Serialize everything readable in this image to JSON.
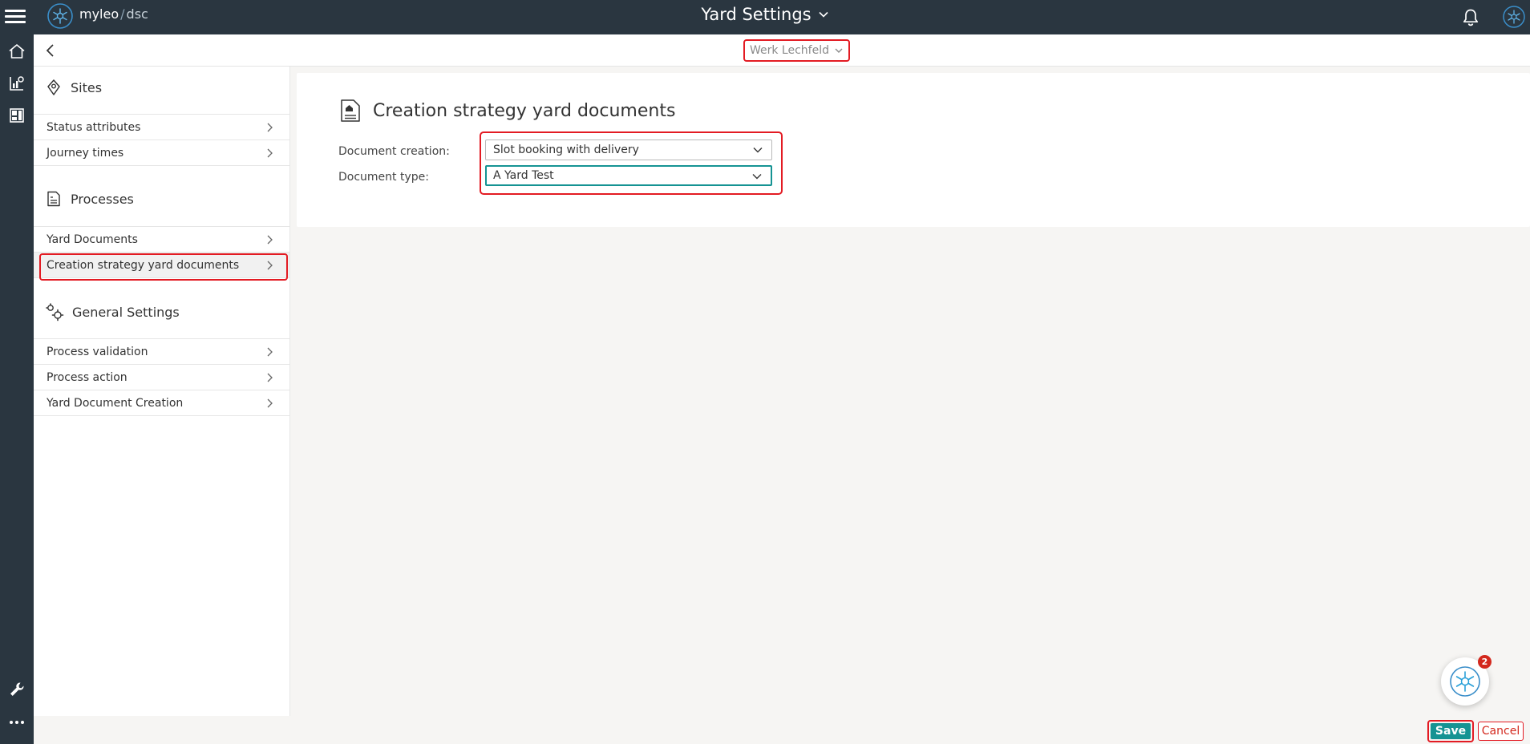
{
  "header": {
    "brand_name": "myleo",
    "brand_separator": "/",
    "brand_suffix": "dsc",
    "page_title": "Yard Settings",
    "icons": [
      "hamburger-menu-icon",
      "logo-icon",
      "chevron-down-icon",
      "bell-icon",
      "user-avatar-icon"
    ]
  },
  "rail": {
    "icons": [
      "home-icon",
      "analytics-icon",
      "dashboard-icon",
      "wrench-icon",
      "more-icon"
    ]
  },
  "subheader": {
    "site_select_value": "Werk Lechfeld"
  },
  "sidebar": {
    "sections": [
      {
        "title": "Sites",
        "icon": "map-pin-icon",
        "items": [
          "Status attributes",
          "Journey times"
        ]
      },
      {
        "title": "Processes",
        "icon": "document-list-icon",
        "items": [
          "Yard Documents",
          "Creation strategy yard documents"
        ]
      },
      {
        "title": "General Settings",
        "icon": "gears-icon",
        "items": [
          "Process validation",
          "Process action",
          "Yard Document Creation"
        ]
      }
    ],
    "active_item": "Creation strategy yard documents"
  },
  "main": {
    "title": "Creation strategy yard documents",
    "title_icon": "yard-document-icon",
    "fields": [
      {
        "label": "Document creation:",
        "value": "Slot booking with delivery"
      },
      {
        "label": "Document type:",
        "value": "A Yard Test"
      }
    ]
  },
  "chat": {
    "badge_count": "2"
  },
  "footer": {
    "save_label": "Save",
    "cancel_label": "Cancel"
  },
  "colors": {
    "header_bg": "#2a3640",
    "accent_teal": "#159393",
    "highlight_red": "#e31b23",
    "badge_red": "#d3281d"
  }
}
